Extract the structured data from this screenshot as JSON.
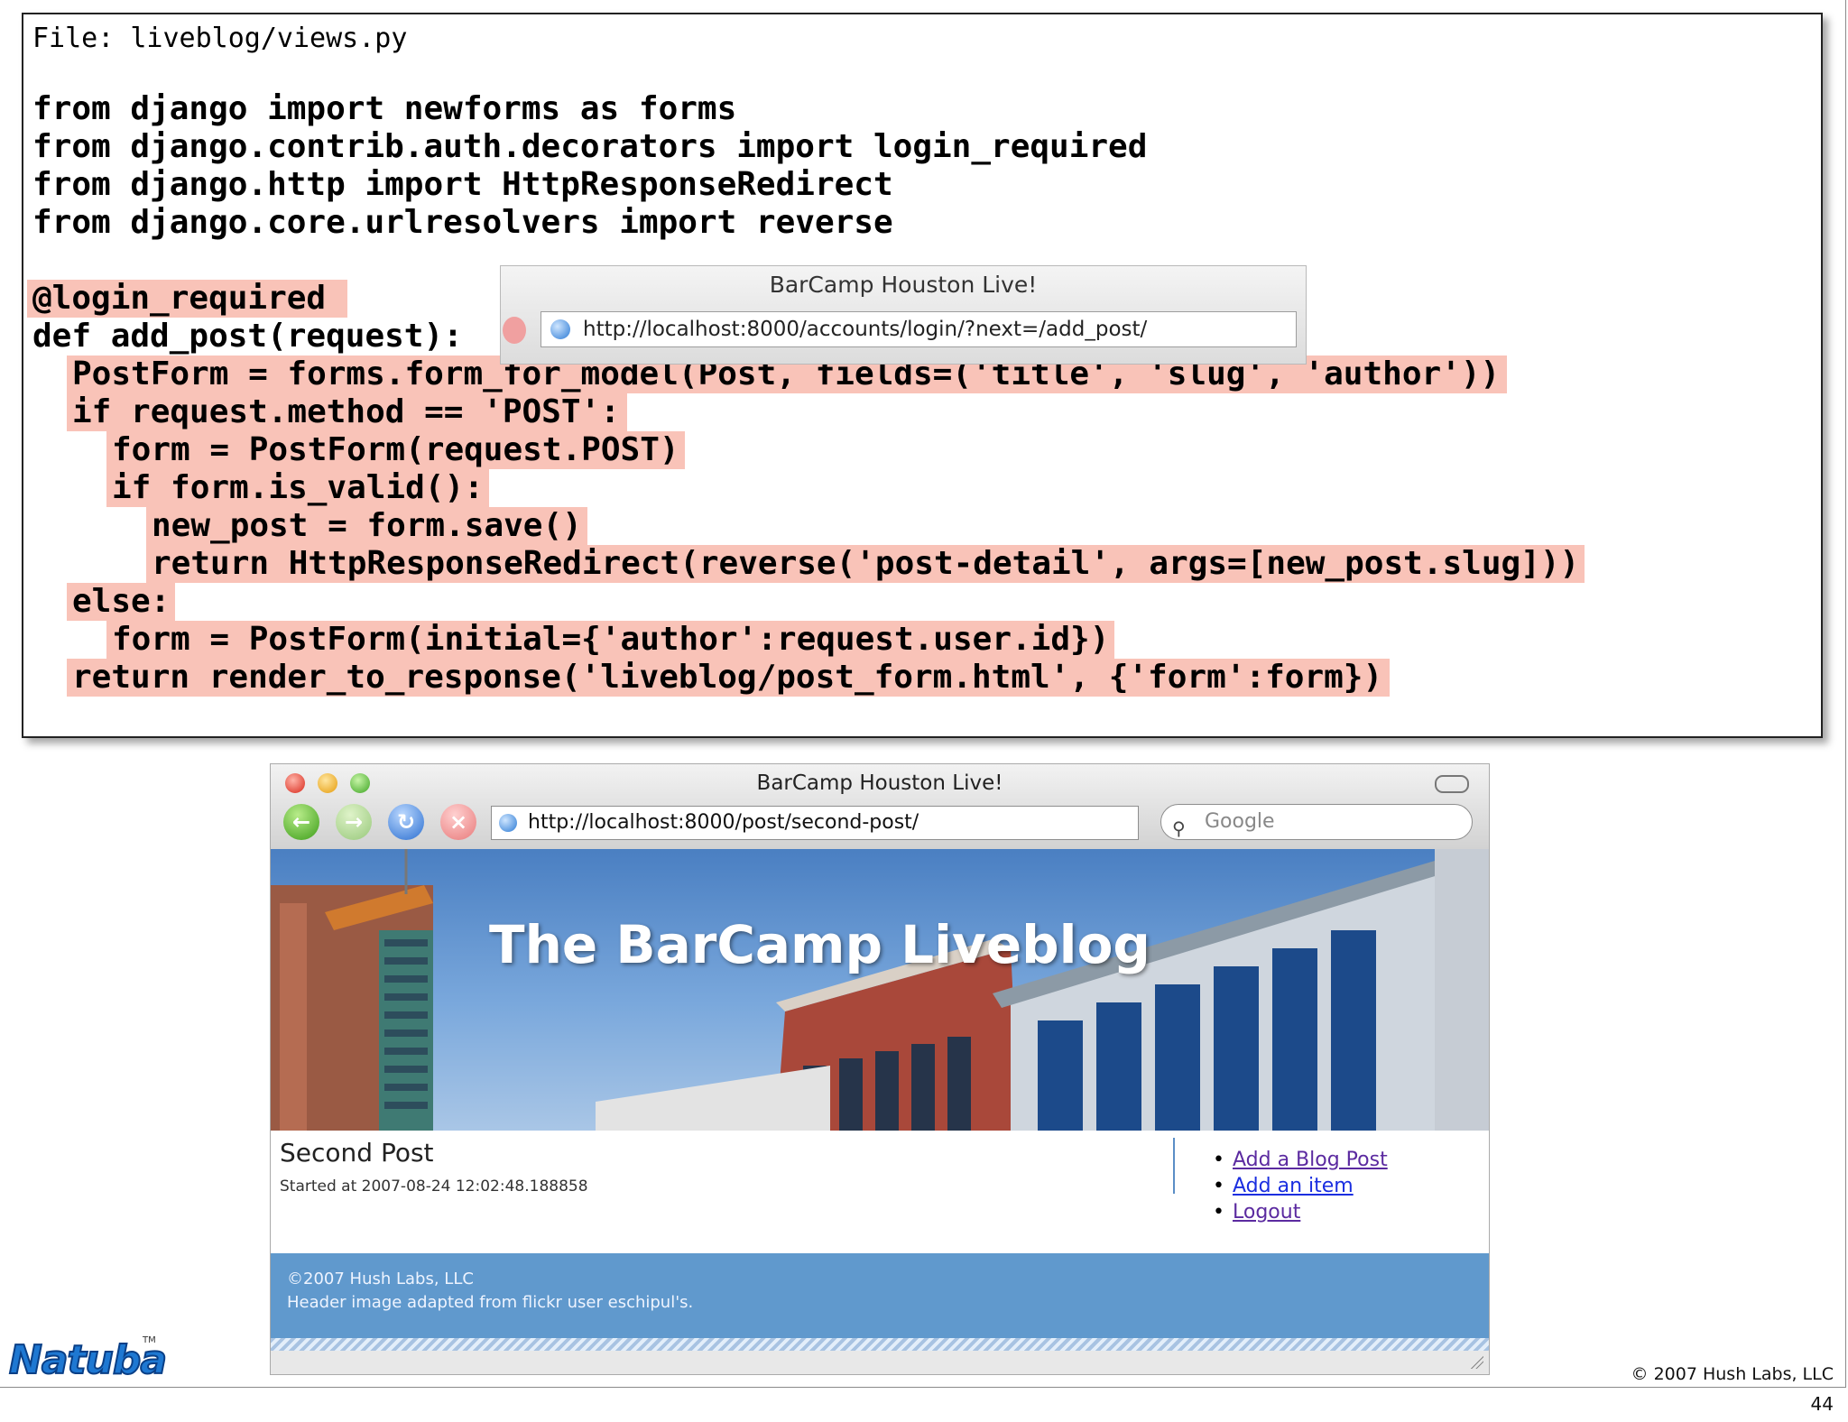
{
  "code": {
    "file_line": "File: liveblog/views.py",
    "lines": [
      "from django import newforms as forms",
      "from django.contrib.auth.decorators import login_required",
      "from django.http import HttpResponseRedirect",
      "from django.core.urlresolvers import reverse",
      "@login_required",
      "def add_post(request):",
      "PostForm = forms.form_for_model(Post, fields=('title', 'slug', 'author'))",
      "if request.method == 'POST':",
      "form = PostForm(request.POST)",
      "if form.is_valid():",
      "new_post = form.save()",
      "return HttpResponseRedirect(reverse('post-detail', args=[new_post.slug]))",
      "else:",
      "form = PostForm(initial={'author':request.user.id})",
      "return render_to_response('liveblog/post_form.html', {'form':form})"
    ]
  },
  "mini_browser": {
    "title": "BarCamp Houston Live!",
    "url": "http://localhost:8000/accounts/login/?next=/add_post/"
  },
  "browser": {
    "title": "BarCamp Houston Live!",
    "url": "http://localhost:8000/post/second-post/",
    "search_placeholder": "Google",
    "nav_icons": [
      "back-icon",
      "forward-icon",
      "reload-icon",
      "stop-icon"
    ]
  },
  "page": {
    "header_title": "The BarCamp Liveblog",
    "post_title": "Second Post",
    "post_meta": "Started at 2007-08-24 12:02:48.188858",
    "links": [
      "Add a Blog Post",
      "Add an item",
      "Logout"
    ],
    "footer_line1": "©2007 Hush Labs, LLC",
    "footer_line2": "Header image adapted from flickr user eschipul's."
  },
  "slide": {
    "logo": "Natuba",
    "tm": "TM",
    "copyright": "© 2007 Hush Labs, LLC",
    "page_number": "44"
  },
  "colors": {
    "highlight": "#f9c3b8",
    "link": "#1a2ee0",
    "footer_bg": "#6099cd"
  }
}
